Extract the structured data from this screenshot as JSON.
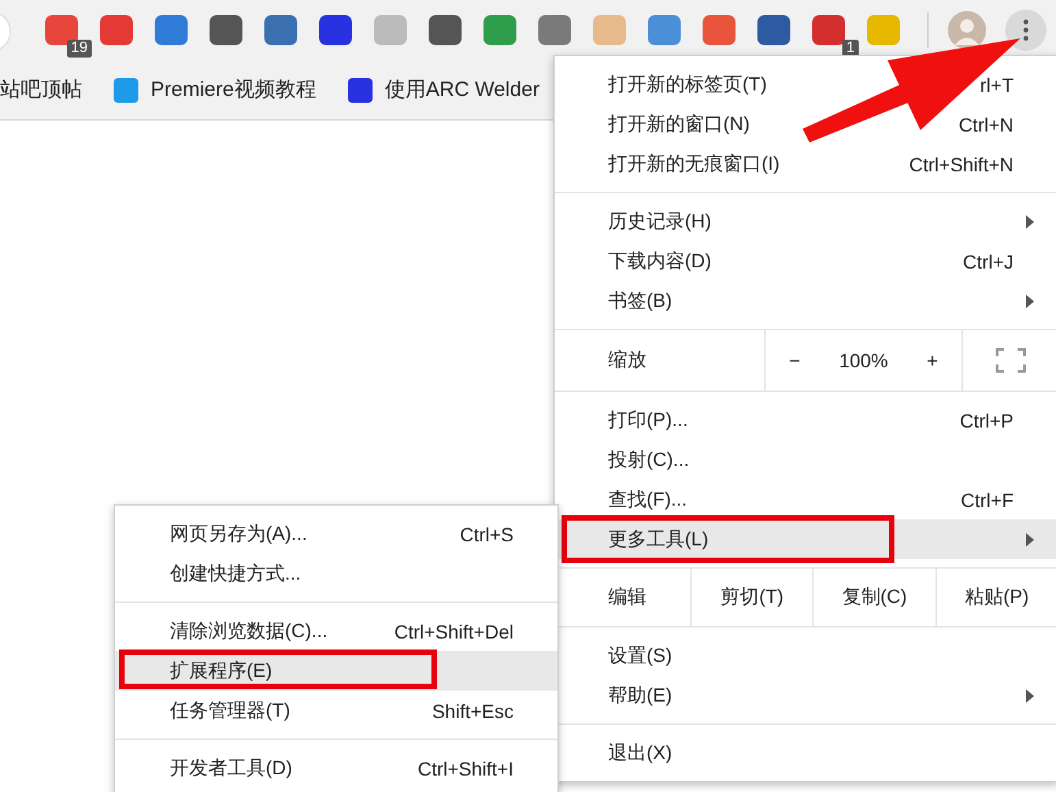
{
  "toolbar": {
    "extensions": [
      {
        "color": "#e8453c",
        "badge": "19"
      },
      {
        "color": "#e53935"
      },
      {
        "color": "#2f7bd8"
      },
      {
        "color": "#555555"
      },
      {
        "color": "#3a6fb0"
      },
      {
        "color": "#2932e1"
      },
      {
        "color": "#bbbbbb"
      },
      {
        "color": "#555555"
      },
      {
        "color": "#2e9e4a"
      },
      {
        "color": "#7a7a7a"
      },
      {
        "color": "#e8b98a"
      },
      {
        "color": "#4a8fd8"
      },
      {
        "color": "#e8553c"
      },
      {
        "color": "#2d5aa0"
      },
      {
        "color": "#d32f2f",
        "badge": "1"
      },
      {
        "color": "#e6b800"
      }
    ]
  },
  "bookmarks": [
    {
      "label": "站吧顶帖"
    },
    {
      "label": "Premiere视频教程",
      "color": "#1e9be8"
    },
    {
      "label": "使用ARC Welder",
      "color": "#2932e1"
    }
  ],
  "main_menu": {
    "sections": [
      {
        "kind": "items",
        "items": [
          {
            "label": "打开新的标签页(T)",
            "shortcut": "rl+T",
            "submenu": false,
            "selected": false,
            "annotated": false
          },
          {
            "label": "打开新的窗口(N)",
            "shortcut": "Ctrl+N",
            "submenu": false,
            "selected": false,
            "annotated": false
          },
          {
            "label": "打开新的无痕窗口(I)",
            "shortcut": "Ctrl+Shift+N",
            "submenu": false,
            "selected": false,
            "annotated": false
          }
        ]
      },
      {
        "kind": "items",
        "items": [
          {
            "label": "历史记录(H)",
            "submenu": true,
            "selected": false,
            "annotated": false
          },
          {
            "label": "下载内容(D)",
            "shortcut": "Ctrl+J",
            "submenu": false,
            "selected": false,
            "annotated": false
          },
          {
            "label": "书签(B)",
            "submenu": true,
            "selected": false,
            "annotated": false
          }
        ]
      },
      {
        "kind": "zoom",
        "label": "缩放",
        "minus": "−",
        "value": "100%",
        "plus": "+"
      },
      {
        "kind": "items",
        "items": [
          {
            "label": "打印(P)...",
            "shortcut": "Ctrl+P",
            "submenu": false,
            "selected": false,
            "annotated": false
          },
          {
            "label": "投射(C)...",
            "submenu": false,
            "selected": false,
            "annotated": false
          },
          {
            "label": "查找(F)...",
            "shortcut": "Ctrl+F",
            "submenu": false,
            "selected": false,
            "annotated": false
          },
          {
            "label": "更多工具(L)",
            "submenu": true,
            "selected": true,
            "annotated": true
          }
        ]
      },
      {
        "kind": "edit",
        "label": "编辑",
        "buttons": [
          "剪切(T)",
          "复制(C)",
          "粘贴(P)"
        ]
      },
      {
        "kind": "items",
        "items": [
          {
            "label": "设置(S)",
            "submenu": false,
            "selected": false,
            "annotated": false
          },
          {
            "label": "帮助(E)",
            "submenu": true,
            "selected": false,
            "annotated": false
          }
        ]
      },
      {
        "kind": "items",
        "items": [
          {
            "label": "退出(X)",
            "submenu": false,
            "selected": false,
            "annotated": false
          }
        ]
      }
    ]
  },
  "sub_menu": {
    "sections": [
      {
        "items": [
          {
            "label": "网页另存为(A)...",
            "shortcut": "Ctrl+S",
            "selected": false,
            "annotated": false
          },
          {
            "label": "创建快捷方式...",
            "selected": false,
            "annotated": false
          }
        ]
      },
      {
        "items": [
          {
            "label": "清除浏览数据(C)...",
            "shortcut": "Ctrl+Shift+Del",
            "selected": false,
            "annotated": false
          },
          {
            "label": "扩展程序(E)",
            "selected": true,
            "annotated": true
          },
          {
            "label": "任务管理器(T)",
            "shortcut": "Shift+Esc",
            "selected": false,
            "annotated": false
          }
        ]
      },
      {
        "items": [
          {
            "label": "开发者工具(D)",
            "shortcut": "Ctrl+Shift+I",
            "selected": false,
            "annotated": false
          }
        ]
      }
    ]
  }
}
